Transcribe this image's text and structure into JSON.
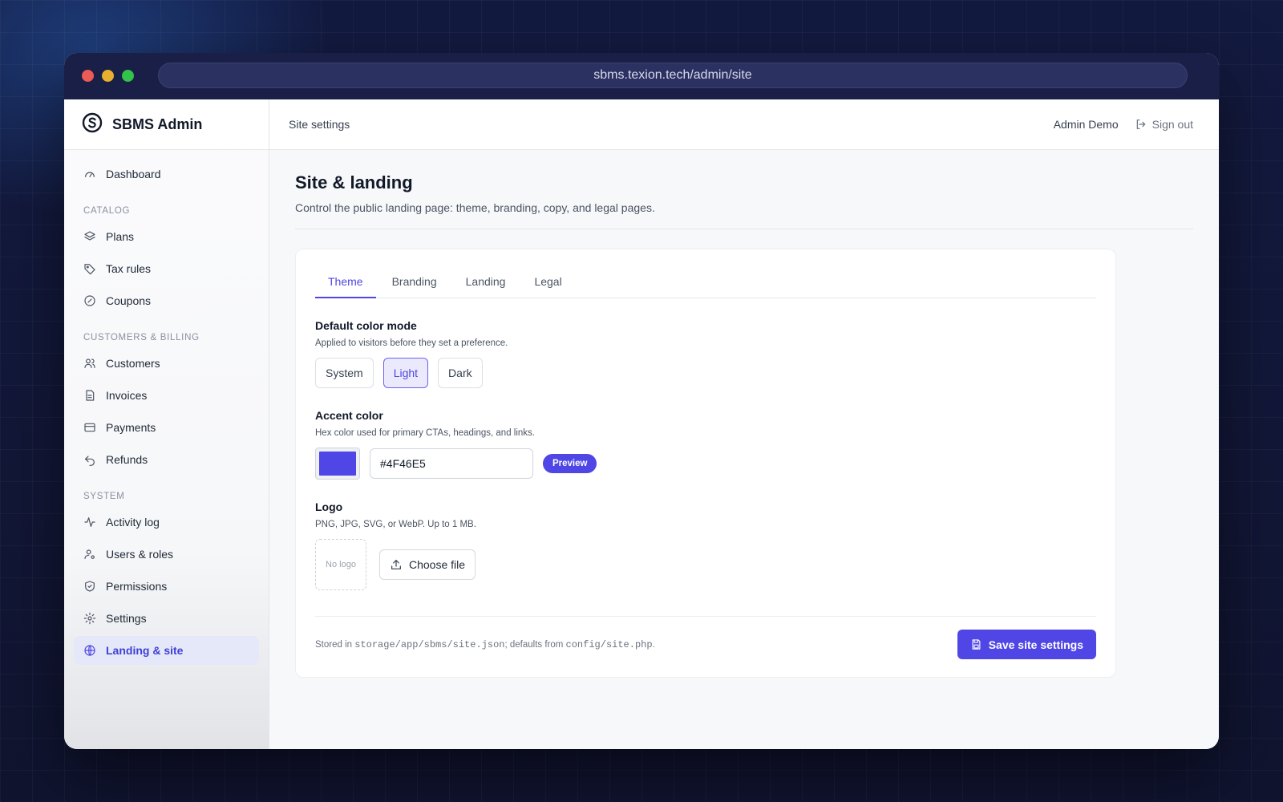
{
  "browser": {
    "url": "sbms.texion.tech/admin/site"
  },
  "brand": {
    "name": "SBMS Admin",
    "icon": "s-logo-icon"
  },
  "sidebar": {
    "top_items": [
      {
        "label": "Dashboard",
        "icon": "gauge-icon"
      }
    ],
    "sections": [
      {
        "title": "CATALOG",
        "items": [
          {
            "label": "Plans",
            "icon": "layers-icon"
          },
          {
            "label": "Tax rules",
            "icon": "tag-icon"
          },
          {
            "label": "Coupons",
            "icon": "percent-badge-icon"
          }
        ]
      },
      {
        "title": "CUSTOMERS & BILLING",
        "items": [
          {
            "label": "Customers",
            "icon": "users-icon"
          },
          {
            "label": "Invoices",
            "icon": "file-icon"
          },
          {
            "label": "Payments",
            "icon": "credit-card-icon"
          },
          {
            "label": "Refunds",
            "icon": "undo-icon"
          }
        ]
      },
      {
        "title": "SYSTEM",
        "items": [
          {
            "label": "Activity log",
            "icon": "activity-icon"
          },
          {
            "label": "Users & roles",
            "icon": "user-cog-icon"
          },
          {
            "label": "Permissions",
            "icon": "shield-check-icon"
          },
          {
            "label": "Settings",
            "icon": "gear-icon"
          },
          {
            "label": "Landing & site",
            "icon": "globe-icon",
            "active": true
          }
        ]
      }
    ]
  },
  "topbar": {
    "crumb": "Site settings",
    "user": "Admin Demo",
    "signout": "Sign out"
  },
  "page": {
    "title": "Site & landing",
    "subtitle": "Control the public landing page: theme, branding, copy, and legal pages."
  },
  "tabs": [
    {
      "label": "Theme",
      "active": true
    },
    {
      "label": "Branding"
    },
    {
      "label": "Landing"
    },
    {
      "label": "Legal"
    }
  ],
  "color_mode": {
    "label": "Default color mode",
    "help": "Applied to visitors before they set a preference.",
    "options": [
      "System",
      "Light",
      "Dark"
    ],
    "selected": "Light"
  },
  "accent": {
    "label": "Accent color",
    "help": "Hex color used for primary CTAs, headings, and links.",
    "value": "#4F46E5",
    "preview_label": "Preview",
    "swatch_color": "#4F46E5"
  },
  "logo": {
    "label": "Logo",
    "help": "PNG, JPG, SVG, or WebP. Up to 1 MB.",
    "placeholder": "No logo",
    "choose_label": "Choose file"
  },
  "footer": {
    "stored_prefix": "Stored in ",
    "stored_path": "storage/app/sbms/site.json",
    "defaults_text": "; defaults from ",
    "defaults_path": "config/site.php",
    "suffix": ".",
    "save_label": "Save site settings"
  },
  "colors": {
    "accent": "#4F46E5",
    "active_nav_bg": "#E5E8F8",
    "titlebar": "#191F47"
  }
}
